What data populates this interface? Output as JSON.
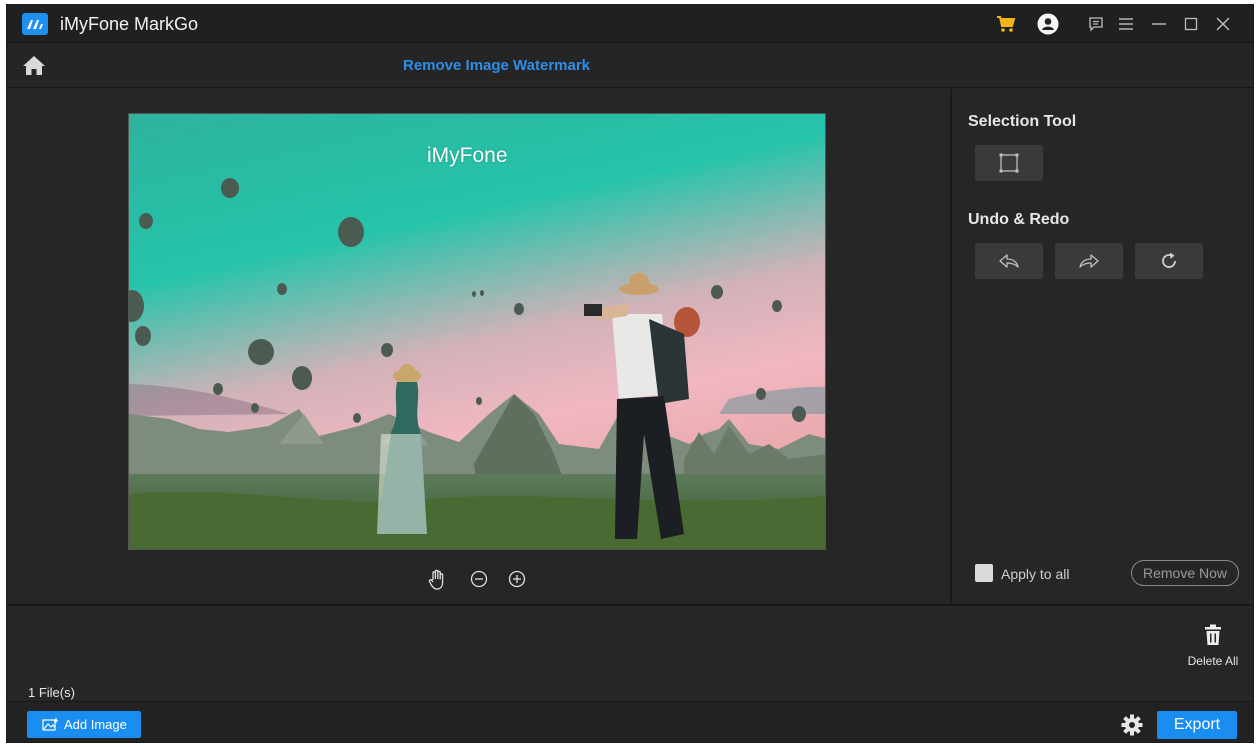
{
  "app": {
    "title": "iMyFone MarkGo",
    "logo_icon": "markgo-logo-icon",
    "accent_color": "#1a8df0"
  },
  "titlebar": {
    "icons": [
      "cart-icon",
      "account-icon",
      "feedback-icon",
      "menu-icon",
      "minimize-icon",
      "maximize-icon",
      "close-icon"
    ]
  },
  "nav": {
    "home_icon": "home-icon",
    "title": "Remove Image Watermark"
  },
  "preview": {
    "watermark_text": "iMyFone",
    "controls": [
      "hand-pan-icon",
      "zoom-out-icon",
      "zoom-in-icon"
    ]
  },
  "side_panel": {
    "selection_title": "Selection Tool",
    "selection_tool_icon": "rectangle-select-icon",
    "undo_redo_title": "Undo & Redo",
    "undo_icon": "undo-icon",
    "redo_icon": "redo-icon",
    "reset_icon": "reset-icon",
    "apply_to_all_label": "Apply to all",
    "apply_to_all_checked": false,
    "remove_now_label": "Remove Now"
  },
  "tray": {
    "delete_all_label": "Delete All",
    "file_count": "1 File(s)"
  },
  "bottom": {
    "add_image_label": "Add Image",
    "export_label": "Export"
  }
}
